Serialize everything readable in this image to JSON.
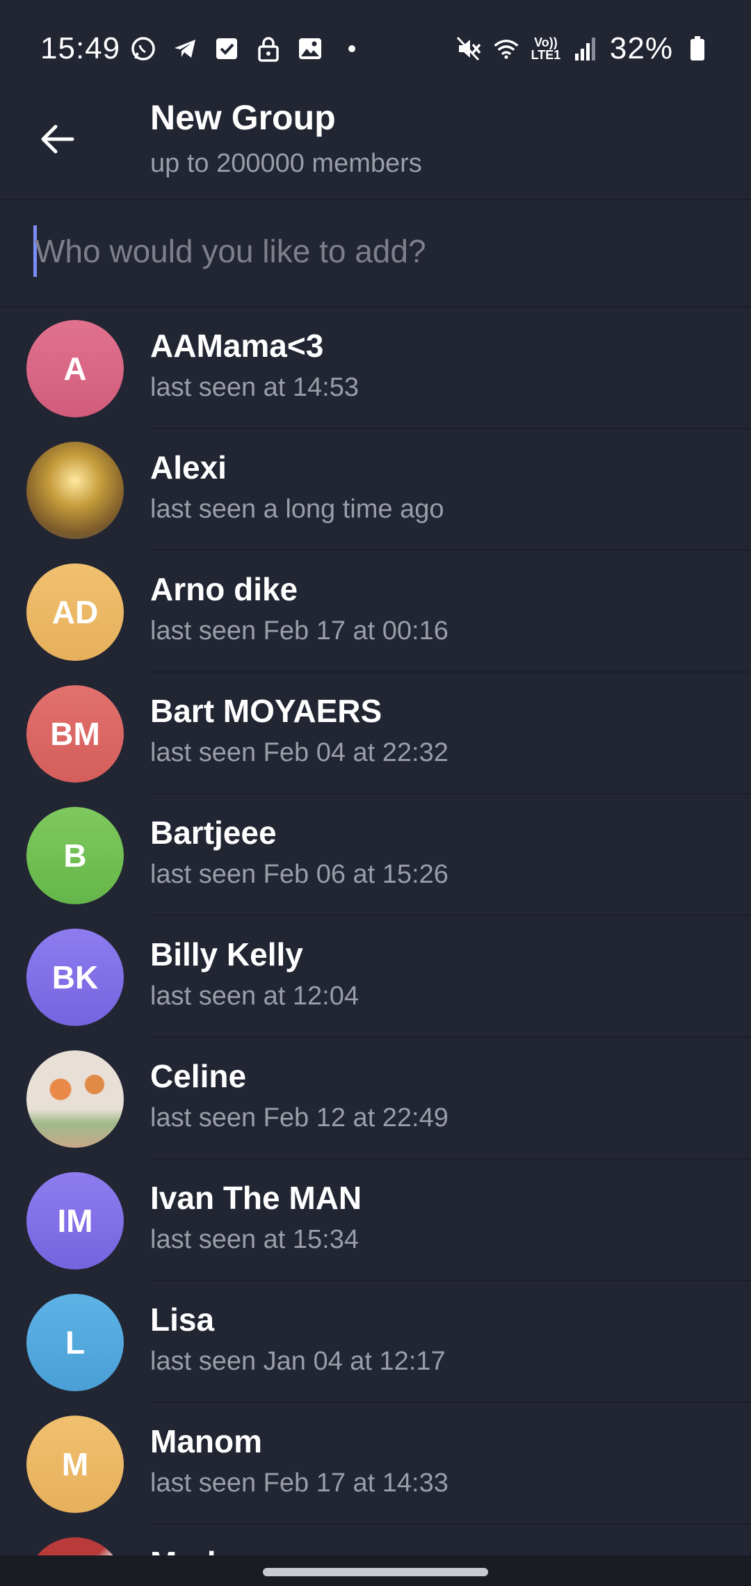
{
  "status_bar": {
    "time": "15:49",
    "battery": "32%",
    "network_label": "Vo)) LTE1",
    "icons_left": [
      "whatsapp-icon",
      "telegram-icon",
      "checkbox-icon",
      "lock-icon",
      "image-icon",
      "dot-icon"
    ],
    "icons_right": [
      "mute-icon",
      "wifi-icon",
      "volte-icon",
      "signal-icon",
      "battery-icon"
    ]
  },
  "header": {
    "title": "New Group",
    "subtitle": "up to 200000 members"
  },
  "search": {
    "placeholder": "Who would you like to add?",
    "value": ""
  },
  "contacts": [
    {
      "initials": "A",
      "name": "AAMama<3",
      "status": "last seen at 14:53",
      "color": "#e0728f",
      "color2": "#d25c7c"
    },
    {
      "initials": "",
      "name": "Alexi",
      "status": "last seen a long time ago",
      "color": "#c49a3a",
      "color2": "#5a5a6a",
      "photo": "golden-sky"
    },
    {
      "initials": "AD",
      "name": "Arno dike",
      "status": "last seen Feb 17 at 00:16",
      "color": "#f0c070",
      "color2": "#e6b05c"
    },
    {
      "initials": "BM",
      "name": "Bart MOYAERS",
      "status": "last seen Feb 04 at 22:32",
      "color": "#e2716d",
      "color2": "#d45e5c"
    },
    {
      "initials": "B",
      "name": "Bartjeee",
      "status": "last seen Feb 06 at 15:26",
      "color": "#7fc95e",
      "color2": "#65b64a"
    },
    {
      "initials": "BK",
      "name": "Billy Kelly",
      "status": "last seen at 12:04",
      "color": "#8e7cf0",
      "color2": "#7564de"
    },
    {
      "initials": "",
      "name": "Celine",
      "status": "last seen Feb 12 at 22:49",
      "color": "#e8e0d6",
      "color2": "#c9a88a",
      "photo": "drawing"
    },
    {
      "initials": "IM",
      "name": "Ivan The MAN",
      "status": "last seen at 15:34",
      "color": "#8e7cf0",
      "color2": "#7564de"
    },
    {
      "initials": "L",
      "name": "Lisa",
      "status": "last seen Jan 04 at 12:17",
      "color": "#5db3e6",
      "color2": "#4a9fd6"
    },
    {
      "initials": "M",
      "name": "Manom",
      "status": "last seen Feb 17 at 14:33",
      "color": "#f0c070",
      "color2": "#e6b05c"
    },
    {
      "initials": "",
      "name": "Mark",
      "status": "",
      "color": "#b83a3a",
      "color2": "#e6e6e6",
      "photo": "partial"
    }
  ],
  "colors": {
    "background": "#222532",
    "accent_cursor": "#7b8cf5",
    "secondary_text": "#9a9ea8"
  }
}
